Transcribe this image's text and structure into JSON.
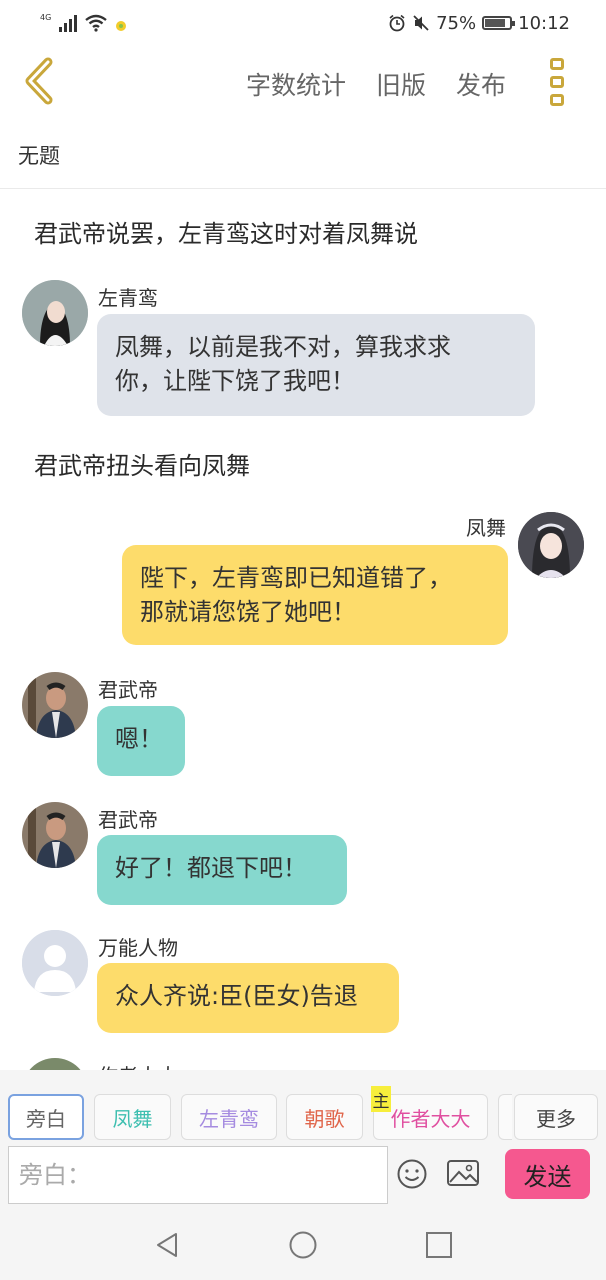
{
  "status_bar": {
    "network": "4G",
    "battery": "75%",
    "battery_level": 0.75,
    "time": "10:12"
  },
  "toolbar": {
    "word_count": "字数统计",
    "old_version": "旧版",
    "publish": "发布"
  },
  "document": {
    "title": "无题"
  },
  "chat": {
    "narration_1": "君武帝说罢，左青鸾这时对着凤舞说",
    "narration_2": "君武帝扭头看向凤舞",
    "messages": [
      {
        "name": "左青鸾",
        "line1": "凤舞，以前是我不对，算我求求",
        "line2": "你，让陛下饶了我吧！"
      },
      {
        "name": "凤舞",
        "line1": "陛下，左青鸾即已知道错了，",
        "line2": "那就请您饶了她吧！"
      },
      {
        "name": "君武帝",
        "text": "嗯！"
      },
      {
        "name": "君武帝",
        "text": "好了！都退下吧！"
      },
      {
        "name": "万能人物",
        "text": "众人齐说:臣(臣女)告退"
      },
      {
        "name": "作者大大"
      }
    ],
    "colors": {
      "gray_bubble": "#dfe3ea",
      "yellow_bubble": "#fddc6b",
      "teal_bubble": "#86d8ce"
    }
  },
  "composer": {
    "roles": [
      {
        "label": "旁白",
        "color": "#666666"
      },
      {
        "label": "凤舞",
        "color": "#3ebfb0"
      },
      {
        "label": "左青鸾",
        "color": "#a58be0"
      },
      {
        "label": "朝歌",
        "color": "#e0664b"
      },
      {
        "label": "作者大大",
        "color": "#e04fa0",
        "badge": "主"
      }
    ],
    "more": "更多",
    "placeholder": "旁白：",
    "send": "发送"
  }
}
